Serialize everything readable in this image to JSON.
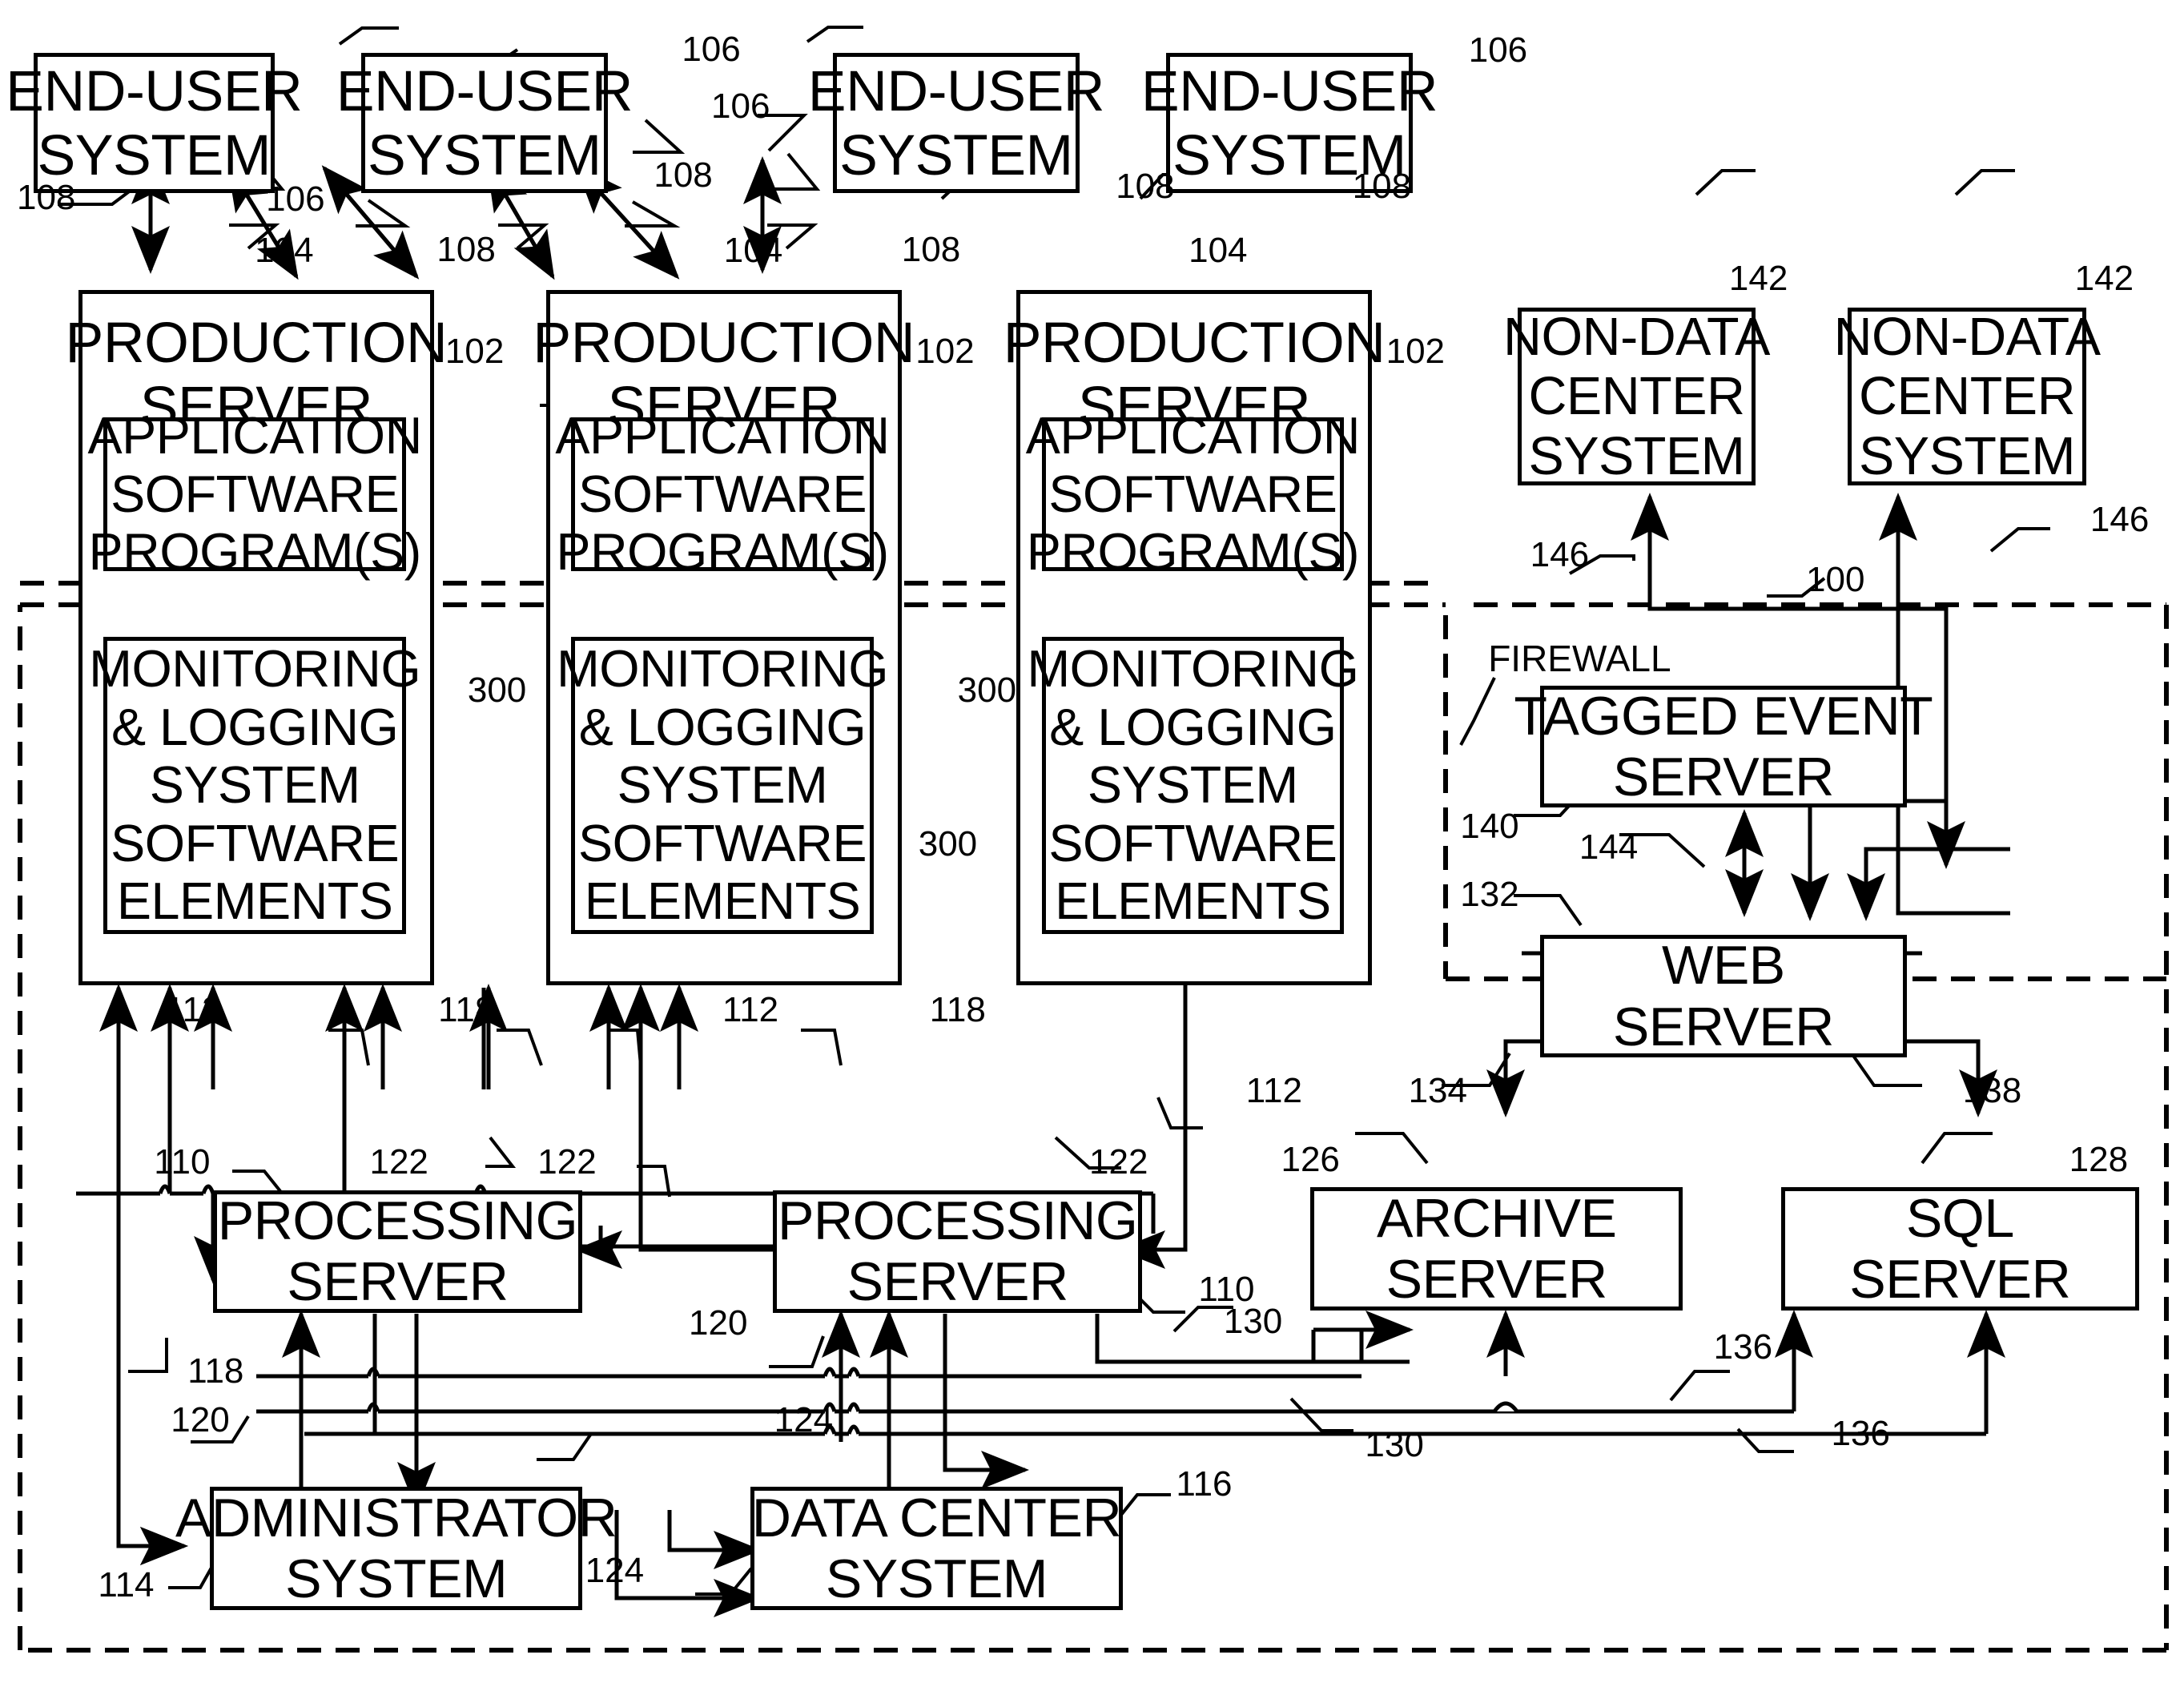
{
  "figure": {
    "type": "patent-block-diagram",
    "background": "#ffffff",
    "line_color": "#000000"
  },
  "boxes": {
    "end_user_1": {
      "lines": [
        "END-USER",
        "SYSTEM"
      ]
    },
    "end_user_2": {
      "lines": [
        "END-USER",
        "SYSTEM"
      ]
    },
    "end_user_3": {
      "lines": [
        "END-USER",
        "SYSTEM"
      ]
    },
    "end_user_4": {
      "lines": [
        "END-USER",
        "SYSTEM"
      ]
    },
    "production_1": {
      "lines": [
        "PRODUCTION",
        "SERVER"
      ]
    },
    "production_2": {
      "lines": [
        "PRODUCTION",
        "SERVER"
      ]
    },
    "production_3": {
      "lines": [
        "PRODUCTION",
        "SERVER"
      ]
    },
    "app_software_1": {
      "lines": [
        "APPLICATION",
        "SOFTWARE",
        "PROGRAM(S)"
      ]
    },
    "app_software_2": {
      "lines": [
        "APPLICATION",
        "SOFTWARE",
        "PROGRAM(S)"
      ]
    },
    "app_software_3": {
      "lines": [
        "APPLICATION",
        "SOFTWARE",
        "PROGRAM(S)"
      ]
    },
    "monitoring_1": {
      "lines": [
        "MONITORING",
        "& LOGGING",
        "SYSTEM",
        "SOFTWARE",
        "ELEMENTS"
      ]
    },
    "monitoring_2": {
      "lines": [
        "MONITORING",
        "& LOGGING",
        "SYSTEM",
        "SOFTWARE",
        "ELEMENTS"
      ]
    },
    "monitoring_3": {
      "lines": [
        "MONITORING",
        "& LOGGING",
        "SYSTEM",
        "SOFTWARE",
        "ELEMENTS"
      ]
    },
    "non_data_center_1": {
      "lines": [
        "NON-DATA",
        "CENTER",
        "SYSTEM"
      ]
    },
    "non_data_center_2": {
      "lines": [
        "NON-DATA",
        "CENTER",
        "SYSTEM"
      ]
    },
    "tagged_event_server": {
      "lines": [
        "TAGGED EVENT",
        "SERVER"
      ]
    },
    "web_server": {
      "lines": [
        "WEB",
        "SERVER"
      ]
    },
    "processing_1": {
      "lines": [
        "PROCESSING",
        "SERVER"
      ]
    },
    "processing_2": {
      "lines": [
        "PROCESSING",
        "SERVER"
      ]
    },
    "archive_server": {
      "lines": [
        "ARCHIVE",
        "SERVER"
      ]
    },
    "sql_server": {
      "lines": [
        "SQL",
        "SERVER"
      ]
    },
    "administrator_system": {
      "lines": [
        "ADMINISTRATOR",
        "SYSTEM"
      ]
    },
    "data_center_system": {
      "lines": [
        "DATA CENTER",
        "SYSTEM"
      ]
    }
  },
  "labels": {
    "firewall": "FIREWALL"
  },
  "refs": [
    {
      "id": "r106_a",
      "text": "106"
    },
    {
      "id": "r106_b",
      "text": "106"
    },
    {
      "id": "r106_c",
      "text": "106"
    },
    {
      "id": "r106_d",
      "text": "106"
    },
    {
      "id": "r108_a",
      "text": "108"
    },
    {
      "id": "r108_b",
      "text": "108"
    },
    {
      "id": "r108_c",
      "text": "108"
    },
    {
      "id": "r108_d",
      "text": "108"
    },
    {
      "id": "r108_e",
      "text": "108"
    },
    {
      "id": "r108_f",
      "text": "108"
    },
    {
      "id": "r104_a",
      "text": "104"
    },
    {
      "id": "r104_b",
      "text": "104"
    },
    {
      "id": "r104_c",
      "text": "104"
    },
    {
      "id": "r102_a",
      "text": "102"
    },
    {
      "id": "r102_b",
      "text": "102"
    },
    {
      "id": "r102_c",
      "text": "102"
    },
    {
      "id": "r142_a",
      "text": "142"
    },
    {
      "id": "r142_b",
      "text": "142"
    },
    {
      "id": "r146_a",
      "text": "146"
    },
    {
      "id": "r146_b",
      "text": "146"
    },
    {
      "id": "r100",
      "text": "100"
    },
    {
      "id": "r300_a",
      "text": "300"
    },
    {
      "id": "r300_b",
      "text": "300"
    },
    {
      "id": "r300_c",
      "text": "300"
    },
    {
      "id": "r140",
      "text": "140"
    },
    {
      "id": "r144",
      "text": "144"
    },
    {
      "id": "r132",
      "text": "132"
    },
    {
      "id": "r112_a",
      "text": "112"
    },
    {
      "id": "r112_b",
      "text": "112"
    },
    {
      "id": "r112_c",
      "text": "112"
    },
    {
      "id": "r118_a",
      "text": "118"
    },
    {
      "id": "r118_b",
      "text": "118"
    },
    {
      "id": "r118_c",
      "text": "118"
    },
    {
      "id": "r110_a",
      "text": "110"
    },
    {
      "id": "r110_b",
      "text": "110"
    },
    {
      "id": "r122_a",
      "text": "122"
    },
    {
      "id": "r122_b",
      "text": "122"
    },
    {
      "id": "r122_c",
      "text": "122"
    },
    {
      "id": "r126",
      "text": "126"
    },
    {
      "id": "r128",
      "text": "128"
    },
    {
      "id": "r134",
      "text": "134"
    },
    {
      "id": "r138",
      "text": "138"
    },
    {
      "id": "r120_a",
      "text": "120"
    },
    {
      "id": "r120_b",
      "text": "120"
    },
    {
      "id": "r130_a",
      "text": "130"
    },
    {
      "id": "r130_b",
      "text": "130"
    },
    {
      "id": "r136_a",
      "text": "136"
    },
    {
      "id": "r136_b",
      "text": "136"
    },
    {
      "id": "r124_a",
      "text": "124"
    },
    {
      "id": "r124_b",
      "text": "124"
    },
    {
      "id": "r114",
      "text": "114"
    },
    {
      "id": "r116",
      "text": "116"
    }
  ]
}
